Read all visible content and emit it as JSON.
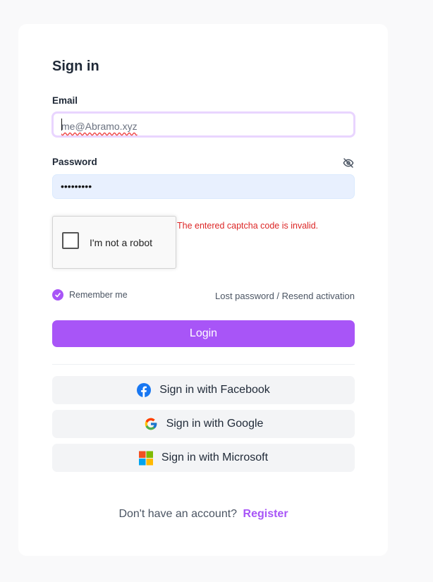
{
  "form": {
    "title": "Sign in",
    "email_label": "Email",
    "email_value": "me@Abramo.xyz",
    "password_label": "Password",
    "password_value": "•••••••••",
    "password_toggle_icon": "eye-slash-icon",
    "captcha_label": "I'm not a robot",
    "captcha_error": "The entered captcha code is invalid.",
    "remember_label": "Remember me",
    "remember_checked": true,
    "lost_password_link": "Lost password / Resend activation",
    "login_button": "Login"
  },
  "social": [
    {
      "label": "Sign in with Facebook",
      "icon": "facebook-icon"
    },
    {
      "label": "Sign in with Google",
      "icon": "google-icon"
    },
    {
      "label": "Sign in with Microsoft",
      "icon": "microsoft-icon"
    }
  ],
  "footer": {
    "prompt": "Don't have an account?",
    "register_link": "Register"
  },
  "colors": {
    "accent": "#a855f7",
    "error": "#dc2626",
    "focus_ring": "#e9d5ff",
    "autofill_bg": "#e8f0fe",
    "facebook": "#1877f2"
  }
}
